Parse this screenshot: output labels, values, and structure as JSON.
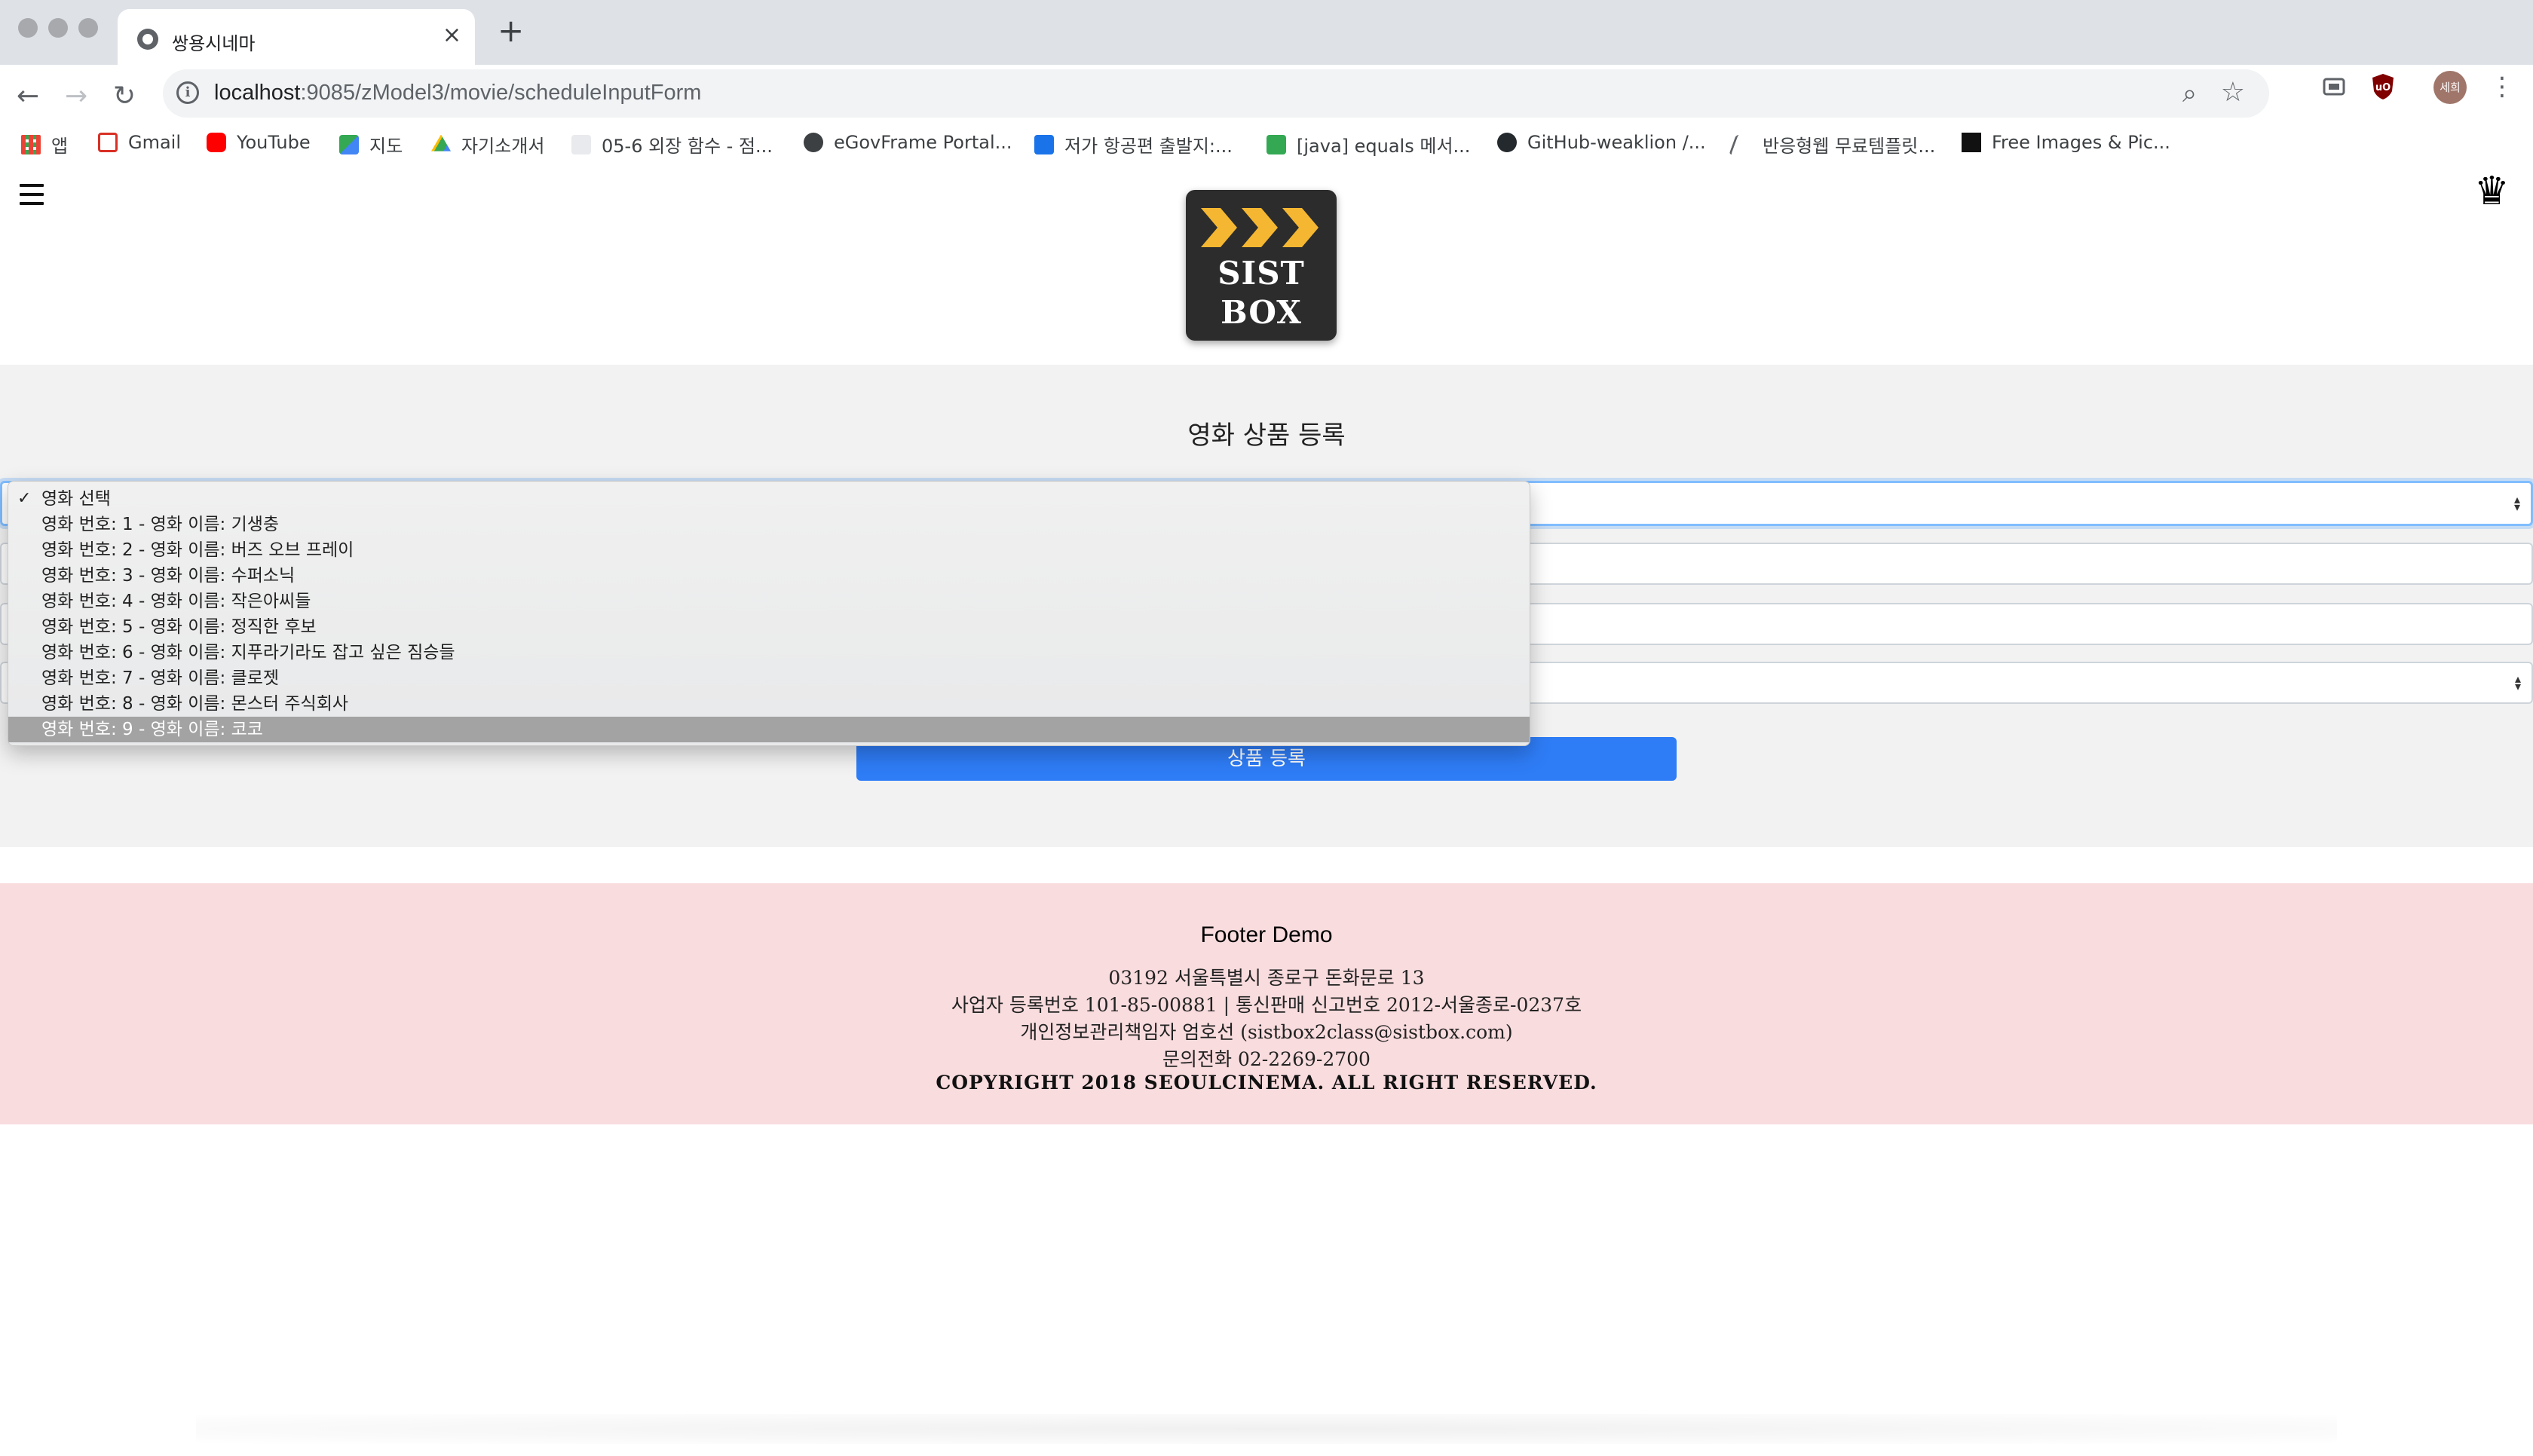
{
  "browser": {
    "tab_title": "쌍용시네마",
    "url_host": "localhost",
    "url_path": ":9085/zModel3/movie/scheduleInputForm",
    "profile_label": "세희",
    "bookmarks": [
      {
        "label": "앱",
        "color": "#ea4335"
      },
      {
        "label": "Gmail",
        "color": "#d93025"
      },
      {
        "label": "YouTube",
        "color": "#ff0000"
      },
      {
        "label": "지도",
        "color": "#34a853"
      },
      {
        "label": "자기소개서",
        "color": "#fbbc04"
      },
      {
        "label": "05-6 외장 함수 - 점...",
        "color": "#9aa0a6"
      },
      {
        "label": "eGovFrame Portal...",
        "color": "#3c4043"
      },
      {
        "label": "저가 항공편 출발지:...",
        "color": "#1a73e8"
      },
      {
        "label": "[java] equals 메서...",
        "color": "#34a853"
      },
      {
        "label": "GitHub-weaklion /...",
        "color": "#24292e"
      },
      {
        "label": "반응형웹 무료템플릿...",
        "color": "#5f6368"
      },
      {
        "label": "Free Images & Pic...",
        "color": "#111111"
      }
    ]
  },
  "header": {
    "logo_line1": "SIST",
    "logo_line2": "BOX"
  },
  "form": {
    "title": "영화 상품 등록",
    "submit_label": "상품 등록",
    "movie_options": [
      "영화 선택",
      "영화 번호: 1 - 영화 이름: 기생충",
      "영화 번호: 2 - 영화 이름: 버즈 오브 프레이",
      "영화 번호: 3 - 영화 이름: 수퍼소닉",
      "영화 번호: 4 - 영화 이름: 작은아씨들",
      "영화 번호: 5 - 영화 이름: 정직한 후보",
      "영화 번호: 6 - 영화 이름: 지푸라기라도 잡고 싶은 짐승들",
      "영화 번호: 7 - 영화 이름: 클로젯",
      "영화 번호: 8 - 영화 이름: 몬스터 주식회사",
      "영화 번호: 9 - 영화 이름: 코코"
    ],
    "checked_option": "영화 선택",
    "highlighted_option": "영화 번호: 9 - 영화 이름: 코코"
  },
  "footer": {
    "heading": "Footer Demo",
    "address": "03192 서울특별시 종로구 돈화문로 13",
    "registration": "사업자 등록번호 101-85-00881 | 통신판매 신고번호 2012-서울종로-0237호",
    "privacy_officer": "개인정보관리책임자 엄호선 (sistbox2class@sistbox.com)",
    "phone": "문의전화 02-2269-2700",
    "copyright": "COPYRIGHT 2018 SEOULCINEMA. ALL RIGHT RESERVED."
  },
  "colors": {
    "accent_blue": "#2e7cf6",
    "footer_bg": "#f9dcde",
    "form_band": "#f2f2f2",
    "logo_chevron": "#f5b731"
  }
}
